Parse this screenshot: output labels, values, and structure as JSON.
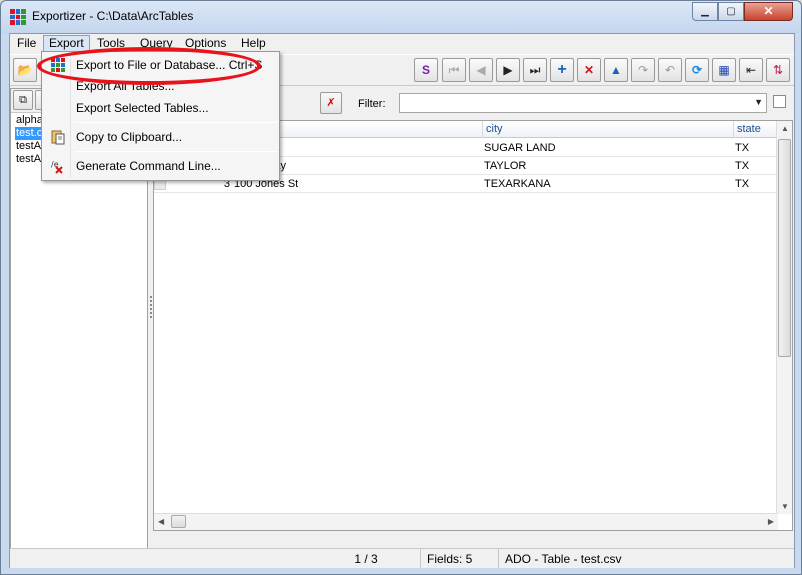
{
  "window": {
    "title": "Exportizer - C:\\Data\\ArcTables",
    "minimize_glyph": "▁",
    "maximize_glyph": "▢",
    "close_glyph": "✕"
  },
  "menubar": {
    "items": [
      "File",
      "Export",
      "Tools",
      "Query",
      "Options",
      "Help"
    ]
  },
  "toolbar_icons": [
    "open-folder-icon",
    "sql-icon",
    "first-record-icon",
    "prior-record-icon",
    "next-record-icon",
    "last-record-icon",
    "insert-record-icon",
    "delete-record-icon",
    "edit-record-icon",
    "post-edit-icon",
    "cancel-edit-icon",
    "refresh-icon",
    "grid-view-icon",
    "fit-columns-icon",
    "sort-icon"
  ],
  "toolbar_glyphs": {
    "first": "⏮",
    "prior": "◀",
    "next": "▶",
    "last": "⏭",
    "insert": "+",
    "delete": "✕",
    "edit": "▲",
    "post": "↷",
    "cancel": "↶",
    "refresh": "⟳",
    "grid": "▦",
    "fit": "⇤",
    "sort": "⇅",
    "open": "📂",
    "sql": "S"
  },
  "table_list": {
    "items": [
      {
        "label": "alphaT",
        "selected": false
      },
      {
        "label": "test.cs",
        "selected": true
      },
      {
        "label": "testAd",
        "selected": false
      },
      {
        "label": "testAc",
        "selected": false
      }
    ]
  },
  "filter": {
    "label": "Filter:",
    "value": "",
    "arrow": "▼"
  },
  "grid": {
    "columns": [
      {
        "name": "",
        "key": "address"
      },
      {
        "name": "city",
        "key": "city"
      },
      {
        "name": "state",
        "key": "state"
      }
    ],
    "rows": [
      {
        "num": "",
        "address": "",
        "city": "SUGAR LAND",
        "state": "TX"
      },
      {
        "num": "",
        "address": "lway",
        "city": "TAYLOR",
        "state": "TX"
      },
      {
        "num": "3",
        "address": "100 Jones St",
        "city": "TEXARKANA",
        "state": "TX"
      }
    ]
  },
  "statusbar": {
    "position": "1 / 3",
    "fields": "Fields: 5",
    "source": "ADO - Table - test.csv"
  },
  "export_menu": {
    "items": [
      {
        "label": "Export to File or Database... Ctrl+S",
        "icon": "export-grid-icon"
      },
      {
        "label": "Export All Tables...",
        "icon": ""
      },
      {
        "label": "Export Selected Tables...",
        "icon": ""
      },
      {
        "label": "Copy to Clipboard...",
        "icon": "clipboard-icon"
      },
      {
        "label": "Generate Command Line...",
        "icon": "command-line-icon"
      }
    ]
  },
  "colors": {
    "highlight": "#e8141c",
    "selection": "#3399ff",
    "header_text": "#1d4e94"
  }
}
